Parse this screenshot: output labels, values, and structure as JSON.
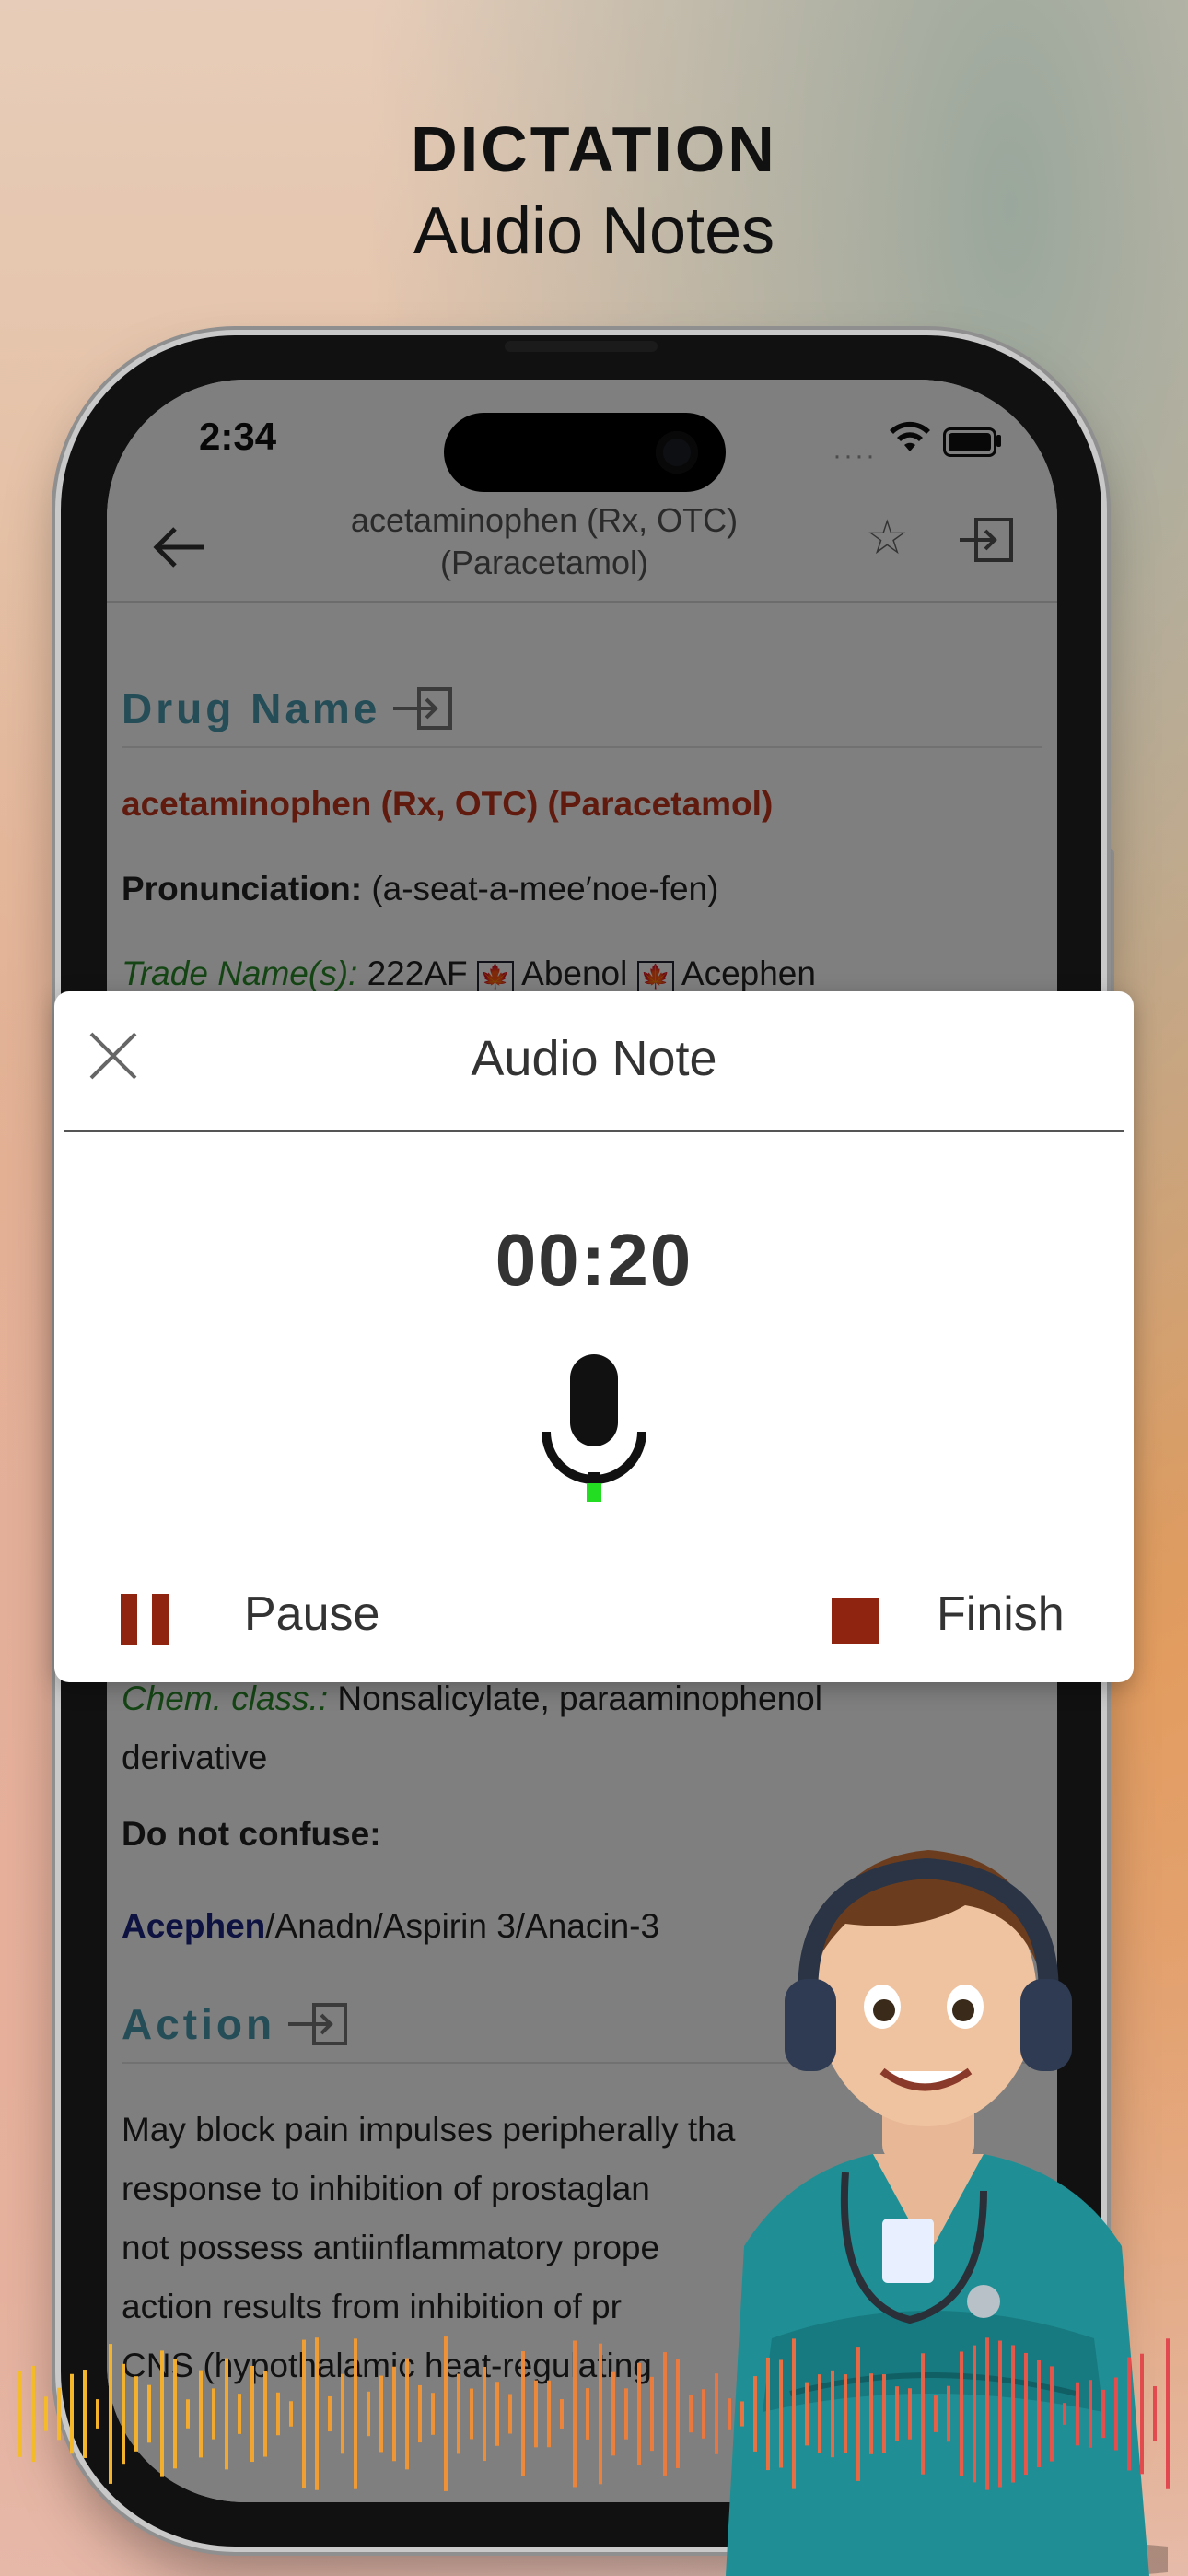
{
  "header": {
    "title": "DICTATION",
    "subtitle": "Audio Notes"
  },
  "status_bar": {
    "time": "2:34"
  },
  "nav": {
    "title": "acetaminophen (Rx, OTC) (Paracetamol)"
  },
  "drug": {
    "section_drug_name": "Drug Name",
    "name": "acetaminophen (Rx, OTC) (Paracetamol)",
    "pronunciation_label": "Pronunciation:",
    "pronunciation": "(a-seat-a-mee′noe-fen)",
    "trade_label": "Trade Name(s):",
    "trade_values": [
      "222AF",
      "Abenol",
      "Acephen"
    ],
    "chem_label": "Chem. class.:",
    "chem_value": "Nonsalicylate, paraaminophenol",
    "chem_value2": "derivative",
    "confuse_label": "Do not confuse:",
    "confuse_first": "Acephen",
    "confuse_rest": "/Anadn/Aspirin 3/Anacin-3",
    "section_action": "Action",
    "action_lines": [
      "May block pain impulses peripherally tha",
      "response to inhibition of prostaglan",
      "not possess antiinflammatory prope",
      "action results from inhibition of pr",
      "CNS (hypothalamic heat-regulating"
    ]
  },
  "modal": {
    "title": "Audio Note",
    "timer": "00:20",
    "pause_label": "Pause",
    "finish_label": "Finish",
    "colors": {
      "control": "#8f2410",
      "level": "#22dd22"
    }
  },
  "icons": [
    "back-arrow-icon",
    "star-icon",
    "export-icon",
    "close-icon",
    "microphone-icon",
    "pause-icon",
    "stop-icon",
    "wifi-icon",
    "battery-icon",
    "canada-flag-icon"
  ]
}
